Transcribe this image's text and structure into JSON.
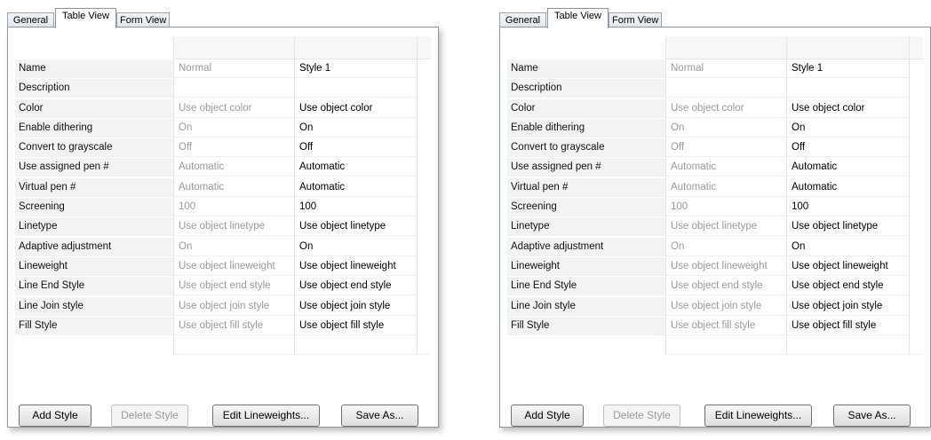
{
  "tabs": [
    "General",
    "Table View",
    "Form View"
  ],
  "columns": {
    "normal": "Normal",
    "style1": "Style 1"
  },
  "rows": [
    {
      "label": "Name",
      "normal": "Normal",
      "style": "Style 1"
    },
    {
      "label": "Description",
      "normal": "",
      "style": ""
    },
    {
      "label": "Color",
      "normal": "Use object color",
      "style": "Use object color"
    },
    {
      "label": "Enable dithering",
      "normal": "On",
      "style": "On"
    },
    {
      "label": "Convert to grayscale",
      "normal": "Off",
      "style": "Off"
    },
    {
      "label": "Use assigned pen #",
      "normal": "Automatic",
      "style": "Automatic"
    },
    {
      "label": "Virtual pen #",
      "normal": "Automatic",
      "style": "Automatic"
    },
    {
      "label": "Screening",
      "normal": "100",
      "style": "100"
    },
    {
      "label": "Linetype",
      "normal": "Use object linetype",
      "style": "Use object linetype"
    },
    {
      "label": "Adaptive adjustment",
      "normal": "On",
      "style": "On"
    },
    {
      "label": "Lineweight",
      "normal": "Use object lineweight",
      "style": "Use object lineweight"
    },
    {
      "label": "Line End Style",
      "normal": "Use object end style",
      "style": "Use object end style"
    },
    {
      "label": "Line Join style",
      "normal": "Use object join style",
      "style": "Use object join style"
    },
    {
      "label": "Fill Style",
      "normal": "Use object fill style",
      "style": "Use object fill style"
    }
  ],
  "buttons": {
    "add": "Add Style",
    "delete": "Delete Style",
    "edit": "Edit Lineweights...",
    "save": "Save As..."
  },
  "colors": {
    "tab_border": "#8d97a3",
    "disabled_text": "#9a9a9a",
    "label_bg": "#f2f3f5"
  }
}
